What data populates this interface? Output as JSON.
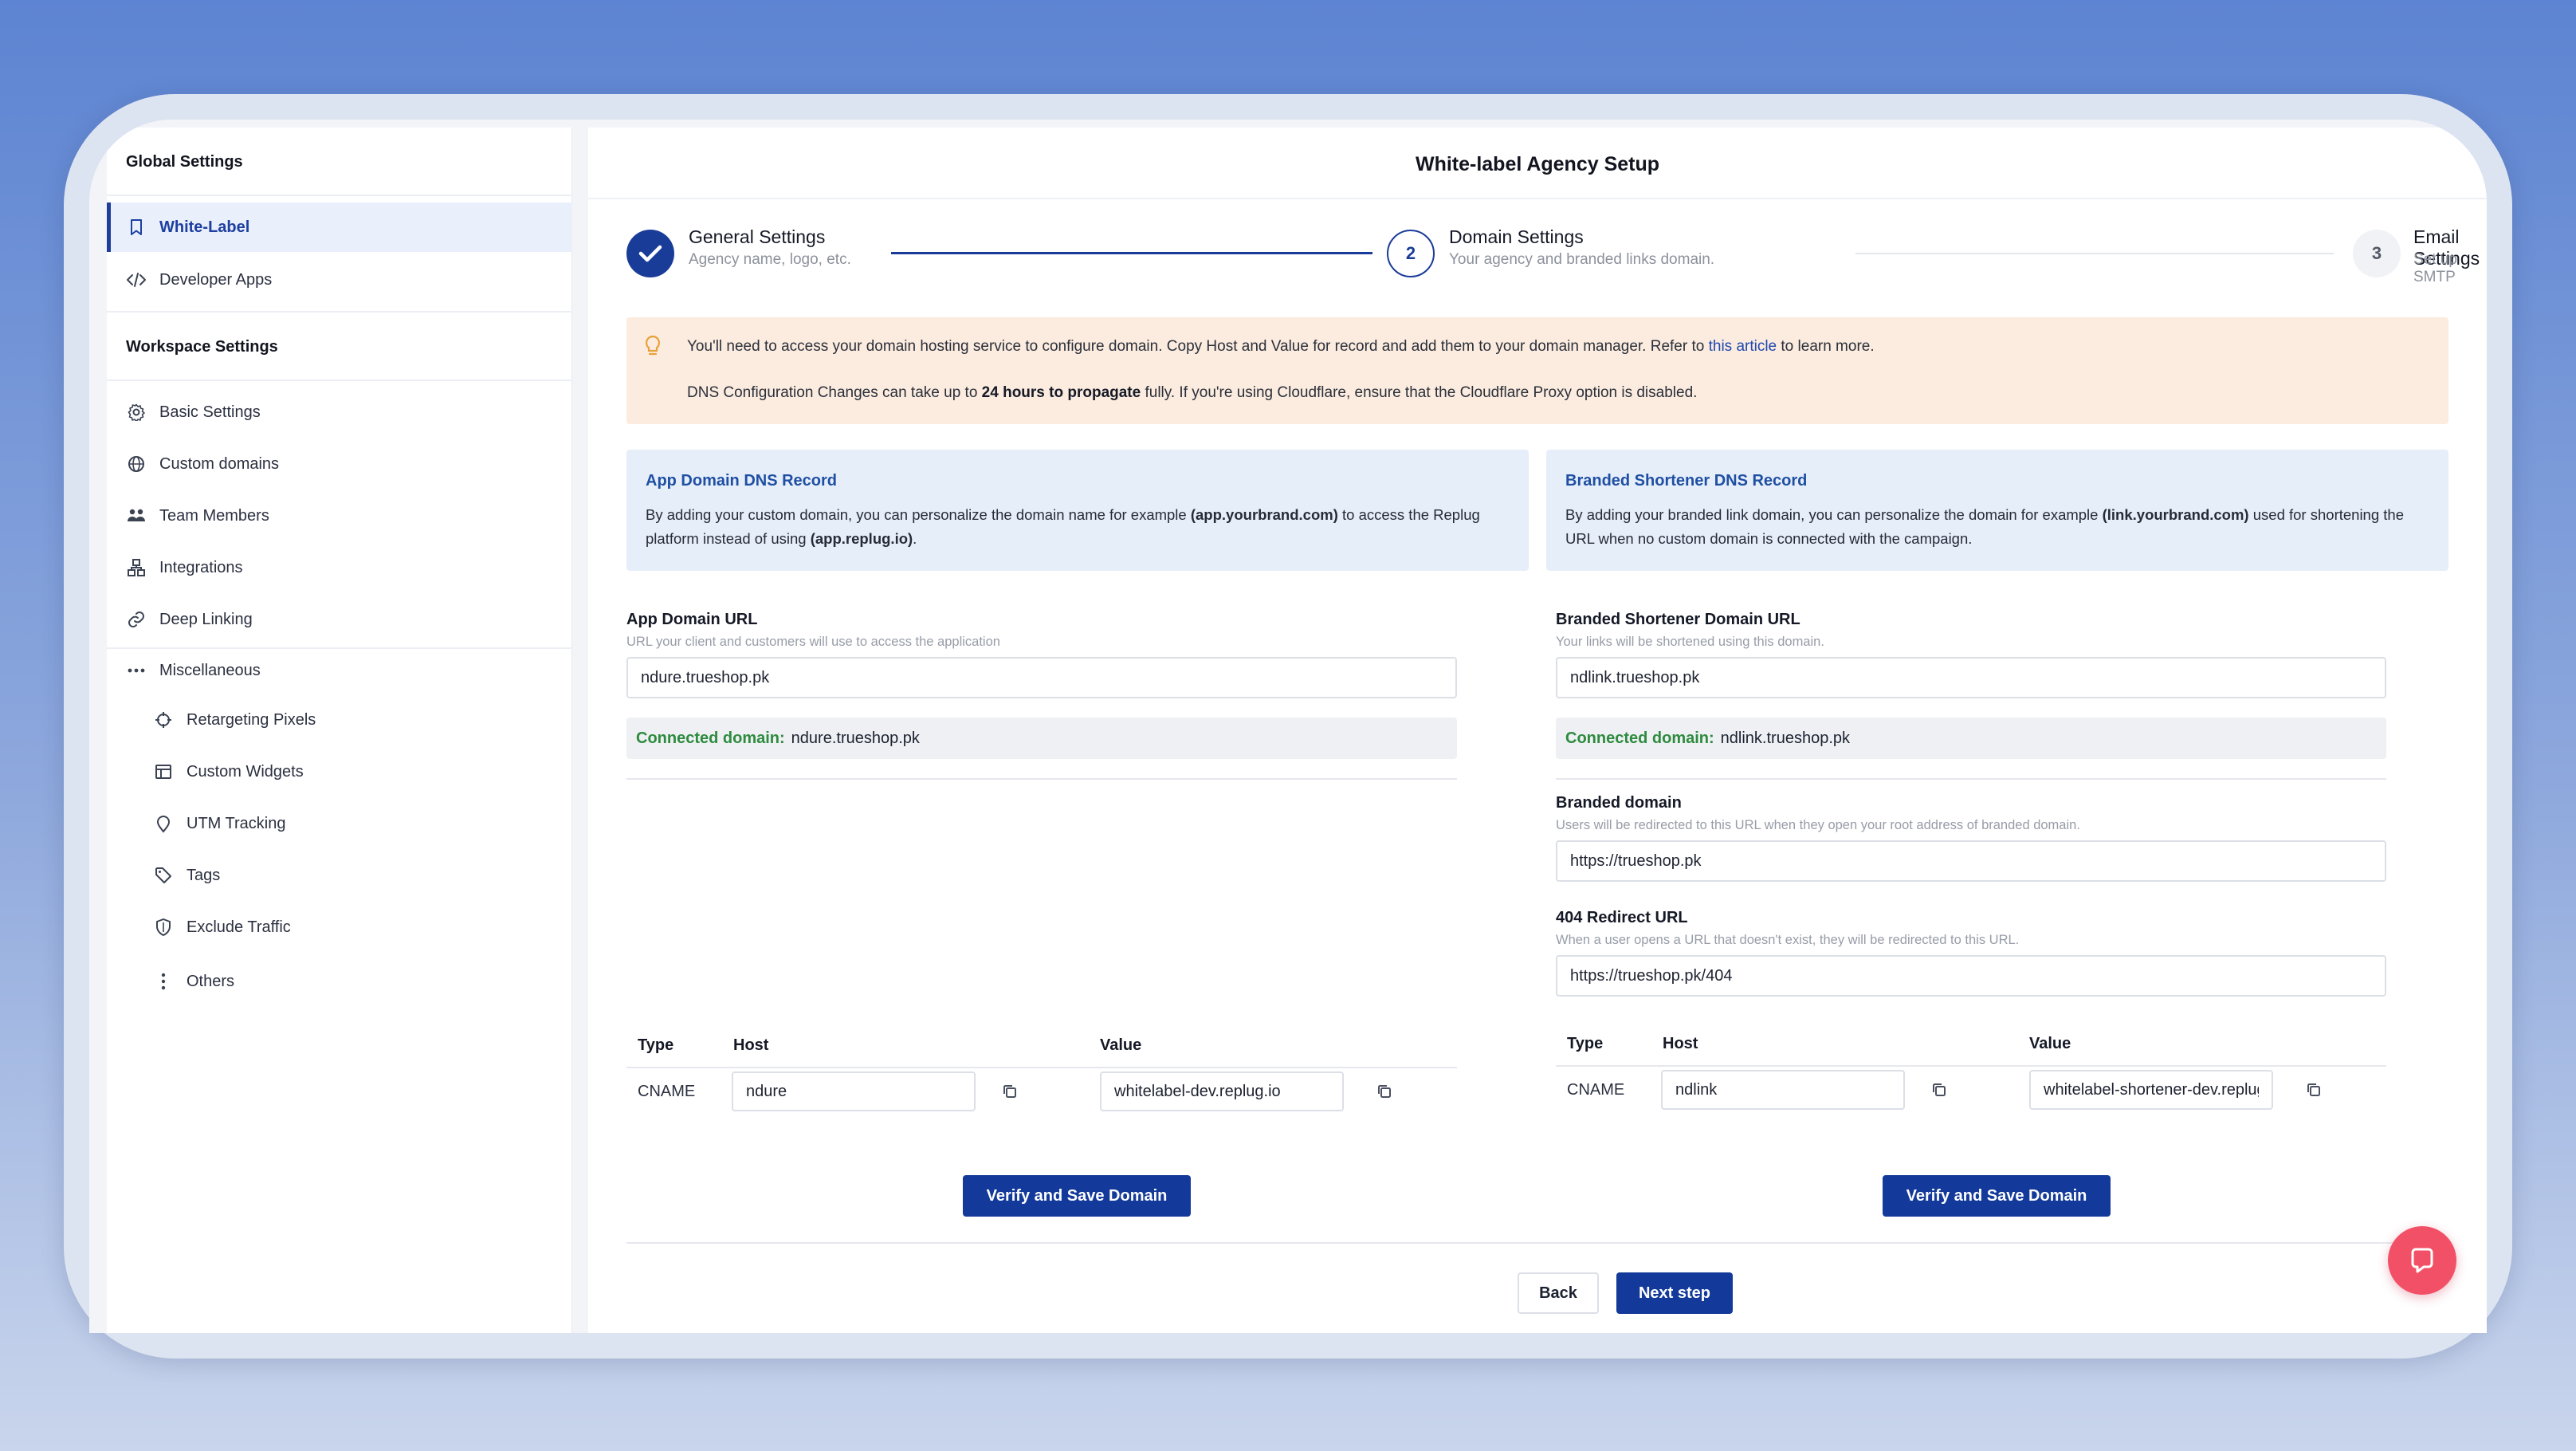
{
  "sidebar": {
    "global_heading": "Global Settings",
    "workspace_heading": "Workspace Settings",
    "global_items": [
      {
        "label": "White-Label",
        "icon": "bookmark-icon",
        "active": true
      },
      {
        "label": "Developer Apps",
        "icon": "code-icon"
      }
    ],
    "workspace_items": [
      {
        "label": "Basic Settings",
        "icon": "gear-icon"
      },
      {
        "label": "Custom domains",
        "icon": "globe-icon"
      },
      {
        "label": "Team Members",
        "icon": "team-icon"
      },
      {
        "label": "Integrations",
        "icon": "integrations-icon"
      },
      {
        "label": "Deep Linking",
        "icon": "link-icon"
      },
      {
        "label": "Miscellaneous",
        "icon": "more-horizontal-icon"
      }
    ],
    "misc_items": [
      {
        "label": "Retargeting Pixels",
        "icon": "target-icon"
      },
      {
        "label": "Custom Widgets",
        "icon": "widget-icon"
      },
      {
        "label": "UTM Tracking",
        "icon": "pin-icon"
      },
      {
        "label": "Tags",
        "icon": "tag-icon"
      },
      {
        "label": "Exclude Traffic",
        "icon": "shield-icon"
      },
      {
        "label": "Others",
        "icon": "more-vertical-icon"
      }
    ]
  },
  "main": {
    "title": "White-label Agency Setup",
    "steps": [
      {
        "number": "",
        "title": "General Settings",
        "subtitle": "Agency name, logo, etc.",
        "state": "done"
      },
      {
        "number": "2",
        "title": "Domain Settings",
        "subtitle": "Your agency and branded links domain.",
        "state": "current"
      },
      {
        "number": "3",
        "title": "Email Settings",
        "subtitle": "Set up SMTP",
        "state": "todo"
      }
    ],
    "alert": {
      "line1_before": "You'll need to access your domain hosting service to configure domain. Copy Host and Value for record and add them to your domain manager. Refer to ",
      "line1_link": "this article",
      "line1_after": " to learn more.",
      "line2_before": "DNS Configuration Changes can take up to ",
      "line2_bold": "24 hours to propagate",
      "line2_after": " fully. If you're using Cloudflare, ensure that the Cloudflare Proxy option is disabled."
    },
    "app_domain": {
      "info_title": "App Domain DNS Record",
      "info_text_1": "By adding your custom domain, you can personalize the domain name for example ",
      "info_bold_1": "(app.yourbrand.com)",
      "info_text_2": " to access the Replug platform instead of using ",
      "info_bold_2": "(app.replug.io)",
      "info_text_3": ".",
      "url_label": "App Domain URL",
      "url_hint": "URL your client and customers will use to access the application",
      "url_value": "ndure.trueshop.pk",
      "connected_label": "Connected domain:",
      "connected_value": "ndure.trueshop.pk",
      "table_headers": {
        "type": "Type",
        "host": "Host",
        "value": "Value"
      },
      "record_type": "CNAME",
      "record_host": "ndure",
      "record_value": "whitelabel-dev.replug.io",
      "verify_button": "Verify and Save Domain"
    },
    "branded_domain": {
      "info_title": "Branded Shortener DNS Record",
      "info_text_1": "By adding your branded link domain, you can personalize the domain for example ",
      "info_bold_1": "(link.yourbrand.com)",
      "info_text_2": " used for shortening the URL when no custom domain is connected with the campaign.",
      "url_label": "Branded Shortener Domain URL",
      "url_hint": "Your links will be shortened using this domain.",
      "url_value": "ndlink.trueshop.pk",
      "connected_label": "Connected domain:",
      "connected_value": "ndlink.trueshop.pk",
      "root_label": "Branded domain",
      "root_hint": "Users will be redirected to this URL when they open your root address of branded domain.",
      "root_value": "https://trueshop.pk",
      "redirect_label": "404 Redirect URL",
      "redirect_hint": "When a user opens a URL that doesn't exist, they will be redirected to this URL.",
      "redirect_value": "https://trueshop.pk/404",
      "table_headers": {
        "type": "Type",
        "host": "Host",
        "value": "Value"
      },
      "record_type": "CNAME",
      "record_host": "ndlink",
      "record_value": "whitelabel-shortener-dev.replug.io",
      "verify_button": "Verify and Save Domain"
    },
    "footer": {
      "back_button": "Back",
      "next_button": "Next step"
    }
  },
  "colors": {
    "accent": "#13399a",
    "connected": "#2e8b3e",
    "alert_bg": "#fbecdf",
    "info_bg": "#e6eef9",
    "chat": "#f25066"
  }
}
